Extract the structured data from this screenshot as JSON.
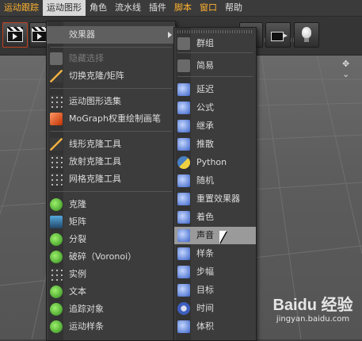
{
  "menubar": {
    "items": [
      {
        "label": "运动跟踪",
        "style": "orange"
      },
      {
        "label": "运动图形",
        "style": "active"
      },
      {
        "label": "角色",
        "style": ""
      },
      {
        "label": "流水线",
        "style": ""
      },
      {
        "label": "插件",
        "style": ""
      },
      {
        "label": "脚本",
        "style": "orange"
      },
      {
        "label": "窗口",
        "style": "orange"
      },
      {
        "label": "帮助",
        "style": ""
      }
    ]
  },
  "toolbar": {
    "icons": [
      "clapper-icon",
      "clapper-icon",
      "cloner-icon",
      "camera-icon",
      "lightbulb-icon"
    ]
  },
  "viewport": {
    "controls": "✥ ⌄"
  },
  "mograph_menu": {
    "effectors_label": "效果器",
    "items": [
      {
        "label": "隐藏选择",
        "icon": "hide-selection-icon",
        "dim": true
      },
      {
        "label": "切换克隆/矩阵",
        "icon": "toggle-clone-matrix-icon"
      },
      {
        "label": "运动图形选集",
        "icon": "mograph-selection-icon"
      },
      {
        "label": "MoGraph权重绘制画笔",
        "icon": "weight-paint-brush-icon"
      },
      {
        "label": "线形克隆工具",
        "icon": "linear-clone-tool-icon"
      },
      {
        "label": "放射克隆工具",
        "icon": "radial-clone-tool-icon"
      },
      {
        "label": "网格克隆工具",
        "icon": "grid-clone-tool-icon"
      },
      {
        "label": "克隆",
        "icon": "cloner-icon"
      },
      {
        "label": "矩阵",
        "icon": "matrix-icon"
      },
      {
        "label": "分裂",
        "icon": "fracture-icon"
      },
      {
        "label": "破碎（Voronoi）",
        "icon": "voronoi-fracture-icon"
      },
      {
        "label": "实例",
        "icon": "instance-icon"
      },
      {
        "label": "文本",
        "icon": "text-icon"
      },
      {
        "label": "追踪对象",
        "icon": "tracer-icon"
      },
      {
        "label": "运动样条",
        "icon": "mospline-icon"
      }
    ]
  },
  "effectors_menu": {
    "items": [
      {
        "label": "群组",
        "icon": "group-effector-icon"
      },
      {
        "label": "简易",
        "icon": "plain-effector-icon"
      },
      {
        "label": "延迟",
        "icon": "delay-effector-icon"
      },
      {
        "label": "公式",
        "icon": "formula-effector-icon"
      },
      {
        "label": "继承",
        "icon": "inheritance-effector-icon"
      },
      {
        "label": "推散",
        "icon": "push-apart-effector-icon"
      },
      {
        "label": "Python",
        "icon": "python-effector-icon"
      },
      {
        "label": "随机",
        "icon": "random-effector-icon"
      },
      {
        "label": "重置效果器",
        "icon": "reeffector-icon"
      },
      {
        "label": "着色",
        "icon": "shader-effector-icon"
      },
      {
        "label": "声音",
        "icon": "sound-effector-icon"
      },
      {
        "label": "样条",
        "icon": "spline-effector-icon"
      },
      {
        "label": "步幅",
        "icon": "step-effector-icon"
      },
      {
        "label": "目标",
        "icon": "target-effector-icon"
      },
      {
        "label": "时间",
        "icon": "time-effector-icon"
      },
      {
        "label": "体积",
        "icon": "volume-effector-icon"
      }
    ]
  },
  "watermark": {
    "brand": "Baidu 经验",
    "url": "jingyan.baidu.com"
  }
}
